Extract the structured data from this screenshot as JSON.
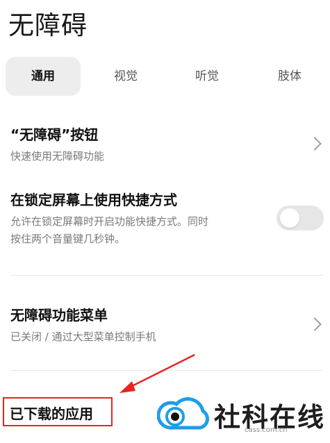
{
  "header": {
    "title": "无障碍"
  },
  "tabs": [
    {
      "label": "通用",
      "active": true
    },
    {
      "label": "视觉",
      "active": false
    },
    {
      "label": "听觉",
      "active": false
    },
    {
      "label": "肢体",
      "active": false
    }
  ],
  "settings": [
    {
      "title": "“无障碍”按钮",
      "desc": "快速使用无障碍功能"
    },
    {
      "title": "在锁定屏幕上使用快捷方式",
      "desc_line1": "允许在锁定屏幕时开启功能快捷方式。同时",
      "desc_line2": "按住两个音量键几秒钟。",
      "toggle_on": false
    },
    {
      "title": "无障碍功能菜单",
      "desc": "已关闭 / 通过大型菜单控制手机"
    },
    {
      "title": "已下载的应用"
    }
  ],
  "annotation": {
    "arrow_color": "#e8231e",
    "box_color": "#e8231e"
  },
  "watermark": {
    "text": "社科在线",
    "url": "cass.com.cn",
    "logo_color": "#1e9ee8"
  }
}
